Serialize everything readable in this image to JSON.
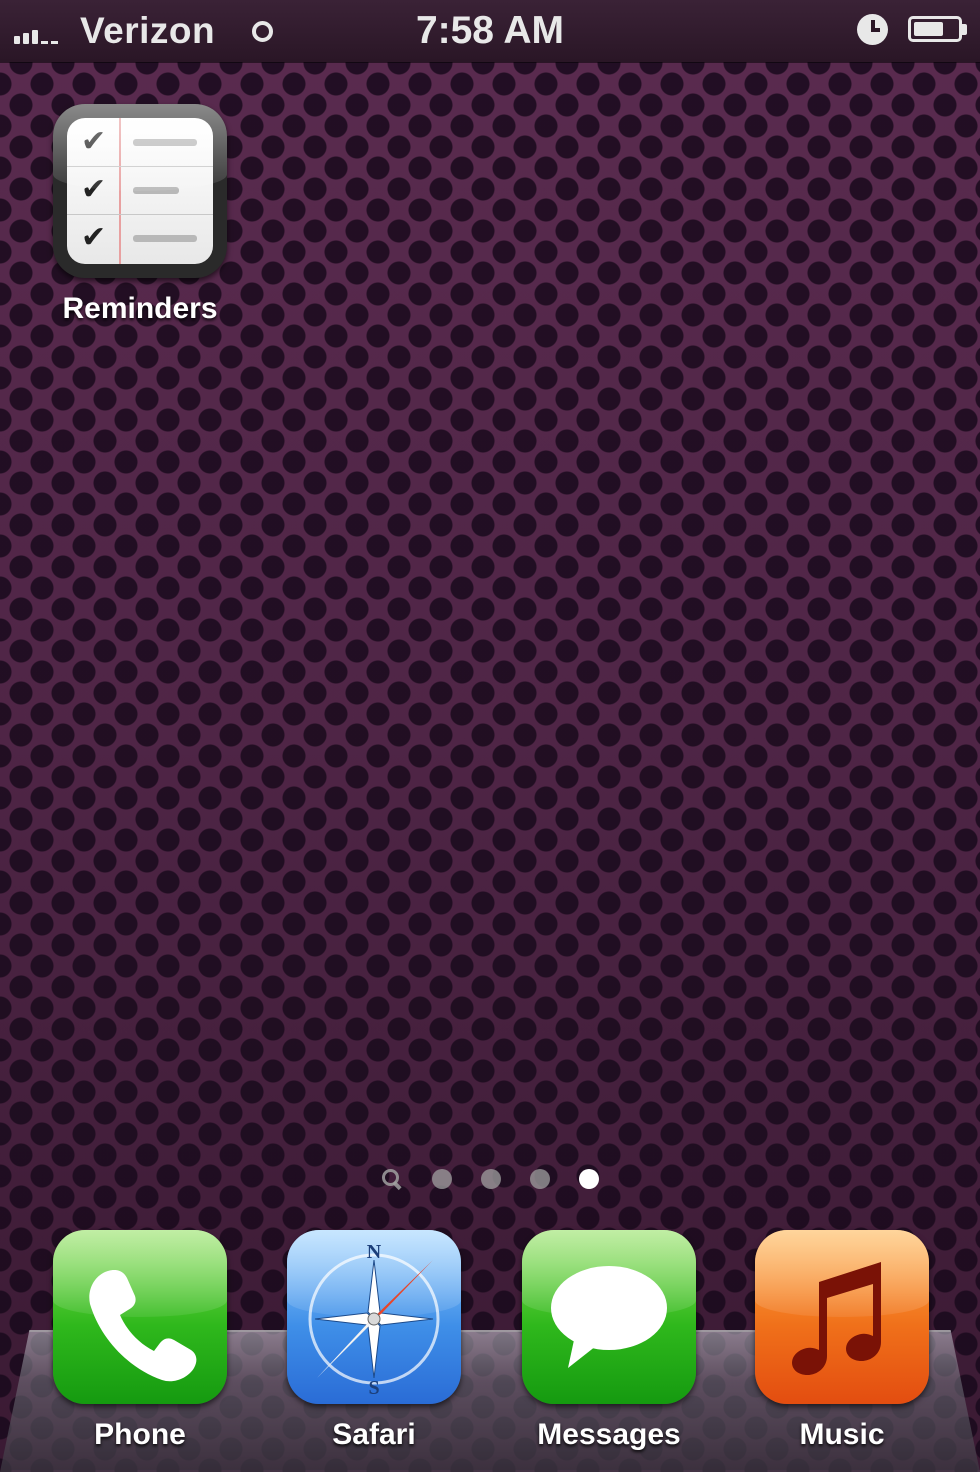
{
  "status_bar": {
    "carrier": "Verizon",
    "time": "7:58 AM",
    "signal_bars": 3,
    "battery_level": 0.7,
    "icons": [
      "signal-icon",
      "wifi-icon",
      "alarm-icon",
      "battery-icon"
    ]
  },
  "home": {
    "apps": [
      {
        "label": "Reminders",
        "icon": "reminders-icon"
      }
    ]
  },
  "page_indicator": {
    "pages": 4,
    "active_page": 4,
    "has_search_page": true
  },
  "dock": {
    "apps": [
      {
        "label": "Phone",
        "icon": "phone-icon",
        "color": "#2fb81c"
      },
      {
        "label": "Safari",
        "icon": "safari-icon",
        "color": "#3f8fe8"
      },
      {
        "label": "Messages",
        "icon": "messages-icon",
        "color": "#2fb81c"
      },
      {
        "label": "Music",
        "icon": "music-icon",
        "color": "#f0701a"
      }
    ]
  },
  "colors": {
    "wallpaper": "#4a2440",
    "status_bar": "#2a1626"
  }
}
